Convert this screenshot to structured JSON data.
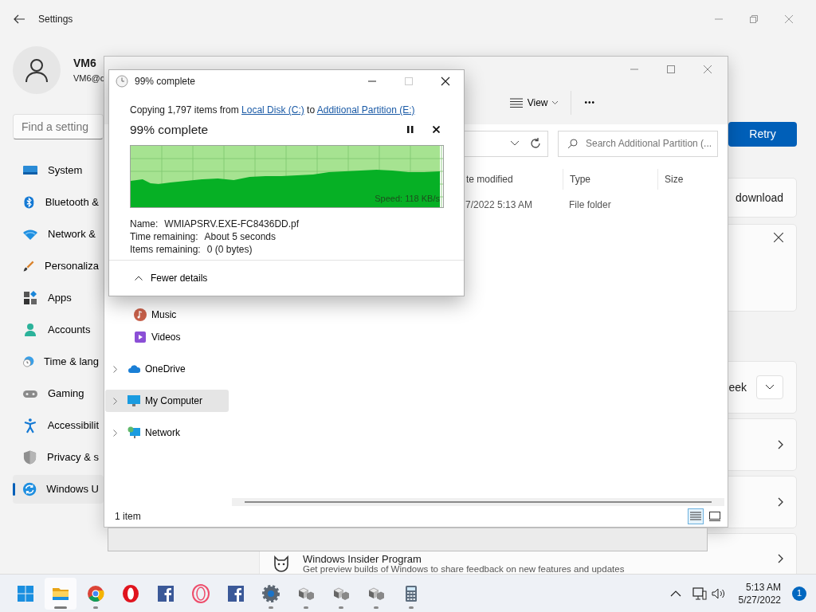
{
  "settings": {
    "title": "Settings",
    "user": {
      "name": "VM6",
      "email": "VM6@c"
    },
    "search": {
      "placeholder": "Find a setting"
    },
    "nav": [
      {
        "label": "System",
        "selected": false
      },
      {
        "label": "Bluetooth &",
        "selected": false
      },
      {
        "label": "Network &",
        "selected": false
      },
      {
        "label": "Personaliza",
        "selected": false
      },
      {
        "label": "Apps",
        "selected": false
      },
      {
        "label": "Accounts",
        "selected": false
      },
      {
        "label": "Time & lang",
        "selected": false
      },
      {
        "label": "Gaming",
        "selected": false
      },
      {
        "label": "Accessibilit",
        "selected": false
      },
      {
        "label": "Privacy & s",
        "selected": false
      },
      {
        "label": "Windows U",
        "selected": true
      }
    ],
    "retry_button": "Retry",
    "cards": [
      {
        "kind": "text",
        "text": "download"
      },
      {
        "kind": "dismiss"
      },
      {
        "kind": "dropdown",
        "text": "eek"
      },
      {
        "kind": "chevron"
      },
      {
        "kind": "chevron"
      },
      {
        "kind": "insider",
        "title": "Windows Insider Program",
        "subtitle": "Get preview builds of Windows to share feedback on new features and updates"
      }
    ]
  },
  "explorer": {
    "toolbar": {
      "view": "View",
      "more": "•••"
    },
    "search": {
      "placeholder": "Search Additional Partition (..."
    },
    "columns": [
      "te modified",
      "Type",
      "Size"
    ],
    "rows": [
      [
        "7/2022 5:13 AM",
        "File folder",
        ""
      ]
    ],
    "nav": [
      {
        "label": "Music",
        "expandable": false,
        "selected": false
      },
      {
        "label": "Videos",
        "expandable": false,
        "selected": false
      },
      {
        "label": "OneDrive",
        "expandable": true,
        "selected": false
      },
      {
        "label": "My Computer",
        "expandable": true,
        "selected": true
      },
      {
        "label": "Network",
        "expandable": true,
        "selected": false
      }
    ],
    "status": "1 item",
    "views": [
      {
        "kind": "details",
        "selected": true
      },
      {
        "kind": "tiles",
        "selected": false
      }
    ]
  },
  "copy_dialog": {
    "title": "99% complete",
    "summary": {
      "prefix": "Copying 1,797 items from",
      "source": "Local Disk (C:)",
      "joiner": "to",
      "destination": "Additional Partition (E:)"
    },
    "heading": "99% complete",
    "progress": {
      "level": 0.99
    },
    "speed": "Speed: 118 KB/s",
    "details": [
      {
        "label": "Name:",
        "value": "WMIAPSRV.EXE-FC8436DD.pf"
      },
      {
        "label": "Time remaining:",
        "value": "About 5 seconds"
      },
      {
        "label": "Items remaining:",
        "value": "0 (0 bytes)"
      }
    ],
    "toggle": "Fewer details"
  },
  "taskbar": {
    "apps": [
      {
        "kind": "start",
        "running": false,
        "active": false
      },
      {
        "kind": "explorer",
        "running": true,
        "active": true
      },
      {
        "kind": "chrome",
        "running": true,
        "active": false
      },
      {
        "kind": "opera",
        "running": false,
        "active": false
      },
      {
        "kind": "facebook",
        "running": false,
        "active": false
      },
      {
        "kind": "opera-outline",
        "running": false,
        "active": false
      },
      {
        "kind": "facebook",
        "running": false,
        "active": false
      },
      {
        "kind": "settings",
        "running": true,
        "active": false
      },
      {
        "kind": "vm",
        "running": true,
        "active": false
      },
      {
        "kind": "vm",
        "running": true,
        "active": false
      },
      {
        "kind": "vm",
        "running": true,
        "active": false
      },
      {
        "kind": "calculator",
        "running": true,
        "active": false
      }
    ],
    "time": "5:13 AM",
    "date": "5/27/2022",
    "notifications": "1"
  }
}
